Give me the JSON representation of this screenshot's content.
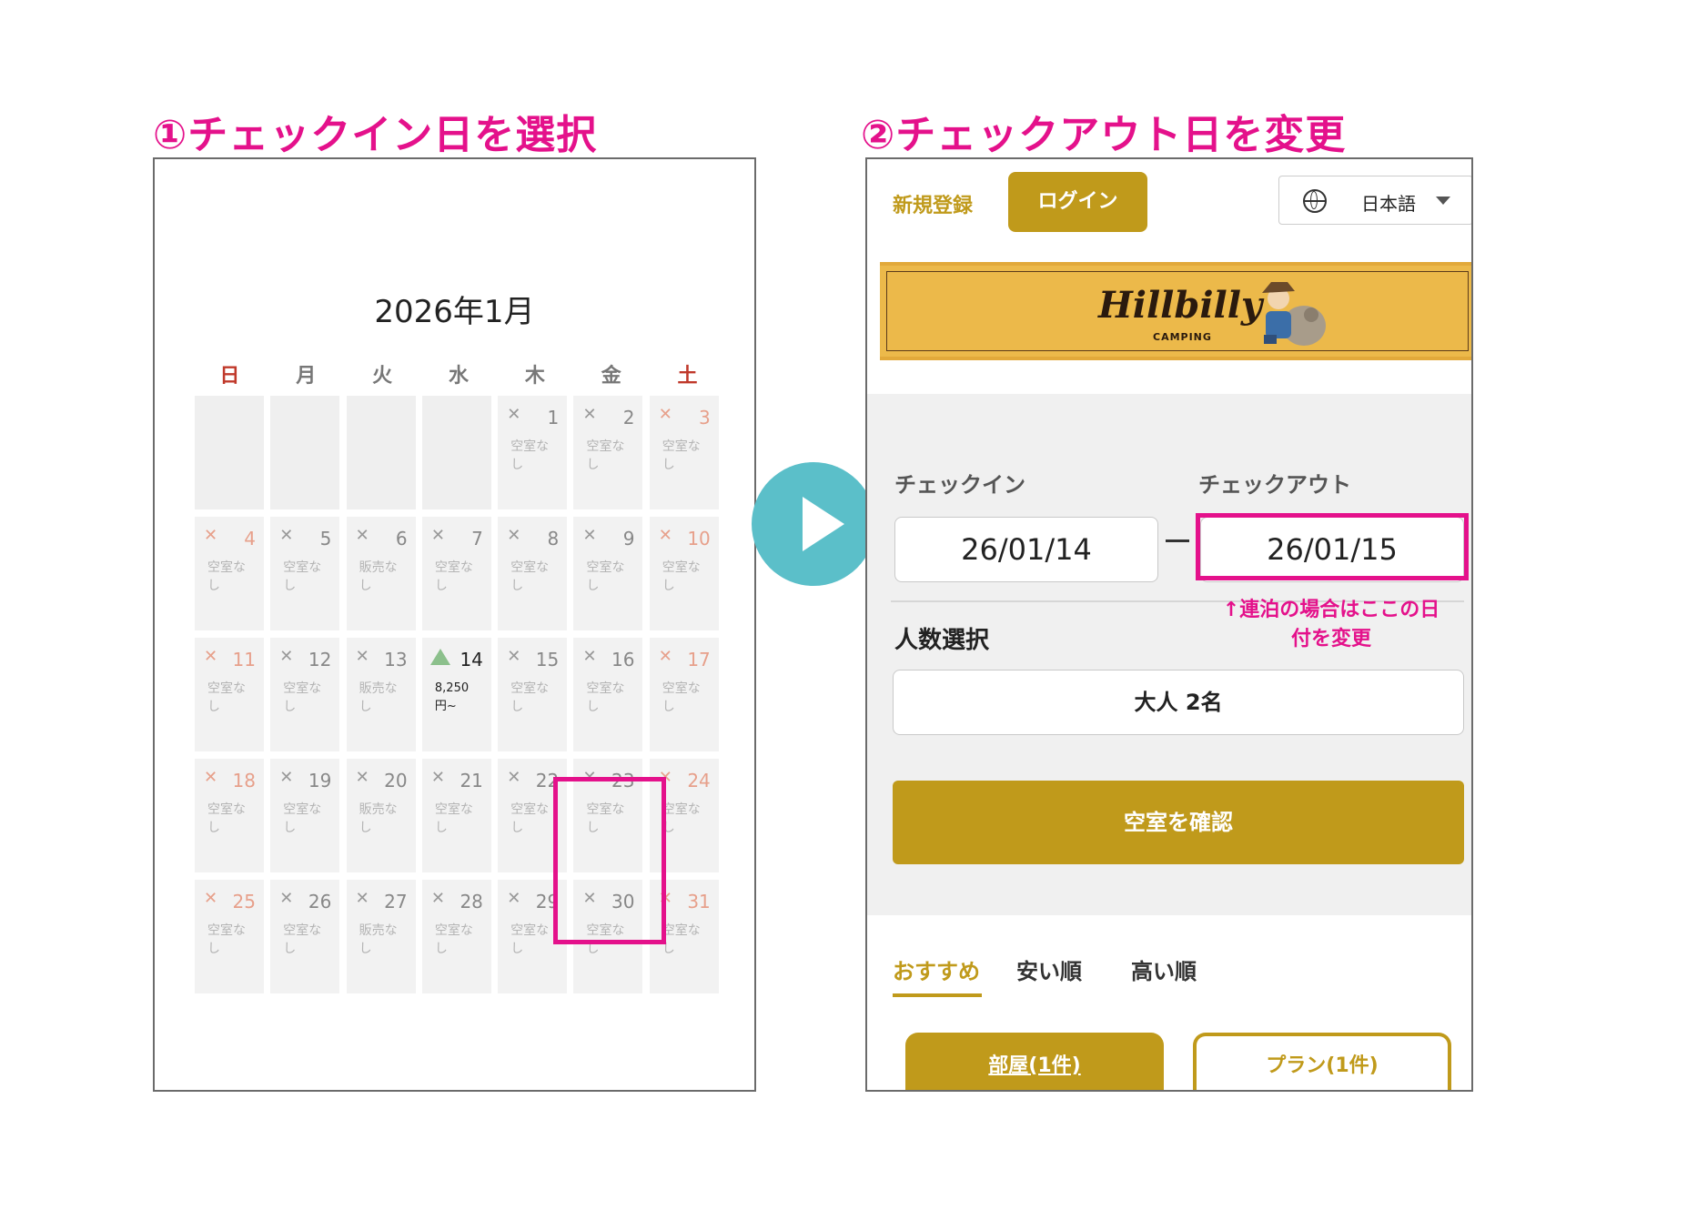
{
  "step1": {
    "title": "①チェックイン日を選択"
  },
  "step2": {
    "title": "②チェックアウト日を変更"
  },
  "calendar": {
    "month": "2026年1月",
    "weekdays": [
      "日",
      "月",
      "火",
      "水",
      "木",
      "金",
      "土"
    ],
    "leading_blank_days": 4,
    "days": [
      {
        "day": "1",
        "mark": "✕",
        "status": "空室なし"
      },
      {
        "day": "2",
        "mark": "✕",
        "status": "空室なし"
      },
      {
        "day": "3",
        "mark": "✕",
        "status": "空室なし"
      },
      {
        "day": "4",
        "mark": "✕",
        "status": "空室なし"
      },
      {
        "day": "5",
        "mark": "✕",
        "status": "空室なし"
      },
      {
        "day": "6",
        "mark": "✕",
        "status": "販売なし"
      },
      {
        "day": "7",
        "mark": "✕",
        "status": "空室なし"
      },
      {
        "day": "8",
        "mark": "✕",
        "status": "空室なし"
      },
      {
        "day": "9",
        "mark": "✕",
        "status": "空室なし"
      },
      {
        "day": "10",
        "mark": "✕",
        "status": "空室なし"
      },
      {
        "day": "11",
        "mark": "✕",
        "status": "空室なし"
      },
      {
        "day": "12",
        "mark": "✕",
        "status": "空室なし"
      },
      {
        "day": "13",
        "mark": "✕",
        "status": "販売なし"
      },
      {
        "day": "14",
        "mark": "▲",
        "status": "8,250円~",
        "available": true
      },
      {
        "day": "15",
        "mark": "✕",
        "status": "空室なし"
      },
      {
        "day": "16",
        "mark": "✕",
        "status": "空室なし"
      },
      {
        "day": "17",
        "mark": "✕",
        "status": "空室なし"
      },
      {
        "day": "18",
        "mark": "✕",
        "status": "空室なし"
      },
      {
        "day": "19",
        "mark": "✕",
        "status": "空室なし"
      },
      {
        "day": "20",
        "mark": "✕",
        "status": "販売なし"
      },
      {
        "day": "21",
        "mark": "✕",
        "status": "空室なし"
      },
      {
        "day": "22",
        "mark": "✕",
        "status": "空室なし"
      },
      {
        "day": "23",
        "mark": "✕",
        "status": "空室なし"
      },
      {
        "day": "24",
        "mark": "✕",
        "status": "空室なし"
      },
      {
        "day": "25",
        "mark": "✕",
        "status": "空室なし"
      },
      {
        "day": "26",
        "mark": "✕",
        "status": "空室なし"
      },
      {
        "day": "27",
        "mark": "✕",
        "status": "販売なし"
      },
      {
        "day": "28",
        "mark": "✕",
        "status": "空室なし"
      },
      {
        "day": "29",
        "mark": "✕",
        "status": "空室なし"
      },
      {
        "day": "30",
        "mark": "✕",
        "status": "空室なし"
      },
      {
        "day": "31",
        "mark": "✕",
        "status": "空室なし"
      }
    ]
  },
  "header": {
    "signup_label": "新規登録",
    "login_label": "ログイン",
    "language_label": "日本語"
  },
  "brand": {
    "logo_text": "Hillbilly",
    "sub_text": "CAMPING"
  },
  "search": {
    "checkin_label": "チェックイン",
    "checkout_label": "チェックアウト",
    "checkin_value": "26/01/14",
    "checkout_value": "26/01/15",
    "checkout_hint": "↑連泊の場合はここの日付を変更",
    "guests_label": "人数選択",
    "guests_value": "大人 2名",
    "submit_label": "空室を確認"
  },
  "sort_tabs": [
    "おすすめ",
    "安い順",
    "高い順"
  ],
  "result_tabs": {
    "rooms": "部屋(1件)",
    "plans": "プラン(1件)"
  },
  "colors": {
    "accent_pink": "#e4118b",
    "brand_gold": "#c09a1b",
    "arrow_teal": "#5bbfc9",
    "banner_yellow": "#ecb94a"
  },
  "icons": {
    "language": "globe-icon",
    "dropdown": "caret-down-icon",
    "next_step": "play-arrow-icon",
    "available": "triangle-icon",
    "unavailable": "cross-icon"
  }
}
